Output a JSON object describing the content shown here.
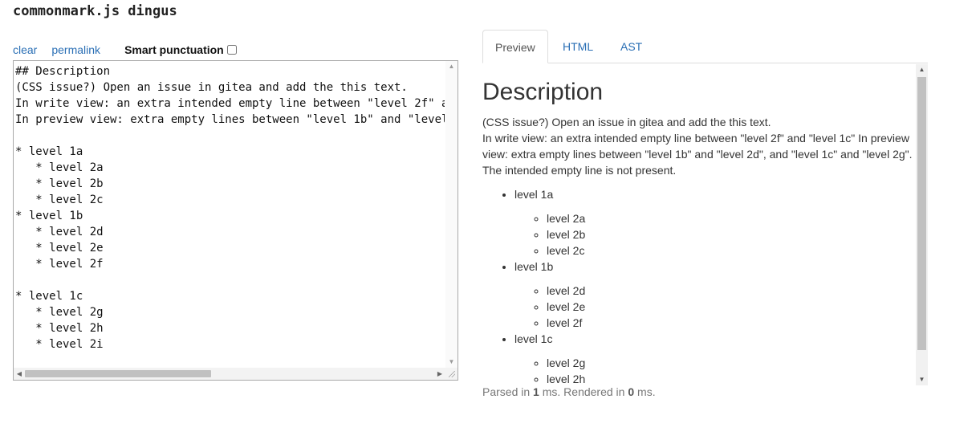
{
  "app": {
    "title": "commonmark.js dingus"
  },
  "controls": {
    "clear_label": "clear",
    "permalink_label": "permalink",
    "smart_punctuation_label": "Smart punctuation",
    "smart_punctuation_checked": false
  },
  "editor": {
    "lines": [
      "## Description",
      "(CSS issue?) Open an issue in gitea and add the this text.",
      "In write view: an extra intended empty line between \"level 2f\" a",
      "In preview view: extra empty lines between \"level 1b\" and \"level",
      "",
      "* level 1a",
      "   * level 2a",
      "   * level 2b",
      "   * level 2c",
      "* level 1b",
      "   * level 2d",
      "   * level 2e",
      "   * level 2f",
      "",
      "* level 1c",
      "   * level 2g",
      "   * level 2h",
      "   * level 2i"
    ]
  },
  "tabs": [
    {
      "label": "Preview",
      "active": true
    },
    {
      "label": "HTML",
      "active": false
    },
    {
      "label": "AST",
      "active": false
    }
  ],
  "preview": {
    "heading": "Description",
    "paragraph_lines": [
      "(CSS issue?) Open an issue in gitea and add the this text.",
      "In write view: an extra intended empty line between \"level 2f\" and \"level 1c\" In preview",
      "view: extra empty lines between \"level 1b\" and \"level 2d\", and \"level 1c\" and \"level 2g\".",
      "The intended empty line is not present."
    ],
    "list": [
      {
        "label": "level 1a",
        "children": [
          "level 2a",
          "level 2b",
          "level 2c"
        ]
      },
      {
        "label": "level 1b",
        "children": [
          "level 2d",
          "level 2e",
          "level 2f"
        ]
      },
      {
        "label": "level 1c",
        "children": [
          "level 2g",
          "level 2h"
        ]
      }
    ]
  },
  "timing": {
    "parsed_prefix": "Parsed in ",
    "parsed_ms": "1",
    "middle": " ms. Rendered in ",
    "rendered_ms": "0",
    "suffix": " ms."
  }
}
